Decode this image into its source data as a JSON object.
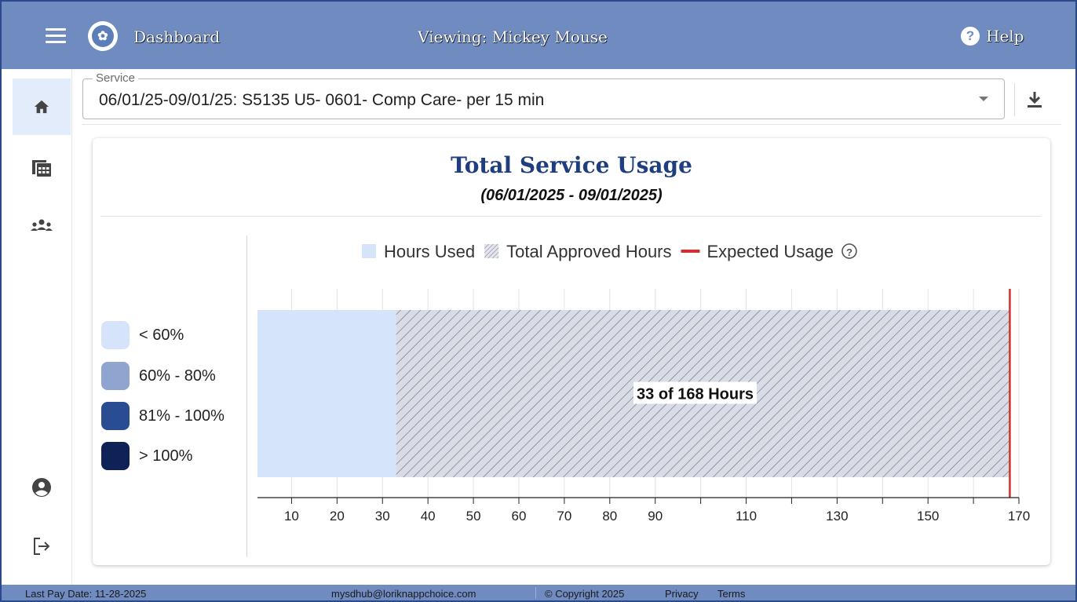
{
  "header": {
    "app_title": "Dashboard",
    "viewing": "Viewing: Mickey Mouse",
    "help_label": "Help",
    "help_icon_glyph": "?",
    "logo_glyph": "✿"
  },
  "sidebar": {
    "items": [
      {
        "name": "home",
        "icon": "home-icon",
        "active": true
      },
      {
        "name": "calendar",
        "icon": "calendar-icon",
        "active": false
      },
      {
        "name": "people",
        "icon": "group-icon",
        "active": false
      },
      {
        "name": "account",
        "icon": "account-circle-icon",
        "active": false
      },
      {
        "name": "logout",
        "icon": "logout-icon",
        "active": false
      }
    ]
  },
  "service_select": {
    "label": "Service",
    "value": "06/01/25-09/01/25: S5135 U5- 0601- Comp Care- per 15 min"
  },
  "card": {
    "title": "Total Service Usage",
    "subtitle": "(06/01/2025 - 09/01/2025)"
  },
  "usage_key": [
    {
      "label": "< 60%",
      "color": "#d6e4fb"
    },
    {
      "label": "60% - 80%",
      "color": "#8fa5d0"
    },
    {
      "label": "81% - 100%",
      "color": "#2a4c93"
    },
    {
      "label": "> 100%",
      "color": "#0e2258"
    }
  ],
  "chart_data": {
    "type": "bar",
    "orientation": "horizontal",
    "legend": [
      {
        "label": "Hours Used",
        "color": "#d6e4fb",
        "style": "solid"
      },
      {
        "label": "Total Approved Hours",
        "color": "#8a93a6",
        "style": "hatched"
      },
      {
        "label": "Expected Usage",
        "color": "#d32f2f",
        "style": "line"
      }
    ],
    "legend_help_icon": "help-outline-icon",
    "series": [
      {
        "name": "Hours Used",
        "values": [
          33
        ]
      },
      {
        "name": "Total Approved Hours",
        "values": [
          168
        ]
      }
    ],
    "expected_usage": 168,
    "bar_label": "33 of 168 Hours",
    "xlim": [
      2.5,
      170
    ],
    "xticks": [
      10,
      20,
      30,
      40,
      50,
      60,
      70,
      80,
      90,
      110,
      130,
      150,
      170
    ],
    "gridlines": [
      10,
      20,
      30,
      40,
      50,
      60,
      70,
      80,
      90,
      100,
      110,
      120,
      130,
      140,
      150,
      160,
      170
    ],
    "grid": true
  },
  "footer": {
    "last_pay": "Last Pay Date: 11-28-2025",
    "email": "mysdhub@loriknappchoice.com",
    "copyright": "© Copyright 2025",
    "privacy": "Privacy",
    "terms": "Terms"
  },
  "colors": {
    "header_bg": "#6f8bc0",
    "footer_bg": "#6f8bc0",
    "title_color": "#1f3e80",
    "active_rail_bg": "#e3ecfa"
  }
}
